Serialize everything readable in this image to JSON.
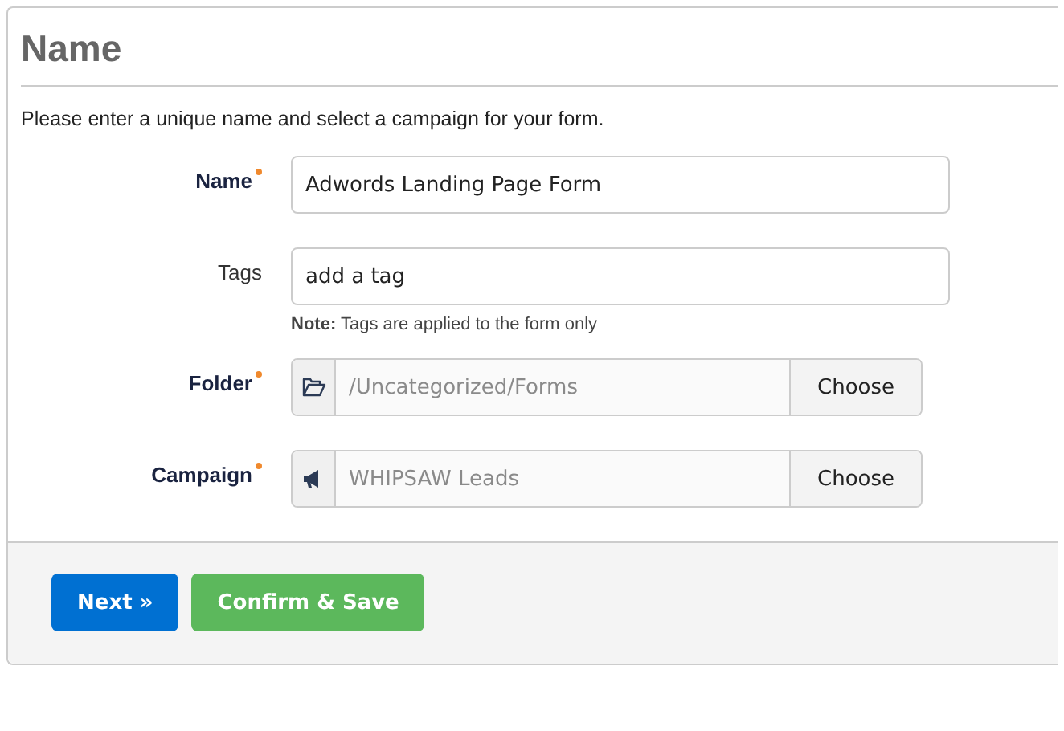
{
  "panel": {
    "title": "Name",
    "intro": "Please enter a unique name and select a campaign for your form.",
    "fields": [
      {
        "label": "Name",
        "required": true,
        "kind": "text",
        "value": "Adwords Landing Page Form"
      },
      {
        "label": "Tags",
        "required": false,
        "kind": "text",
        "value": "add a tag",
        "note": "**Note:** Tags are applied to the form only"
      },
      {
        "label": "Folder",
        "required": true,
        "kind": "folder",
        "placeholder": "/Uncategorized/Forms",
        "button": "Choose"
      },
      {
        "label": "Campaign",
        "required": true,
        "kind": "campaign",
        "placeholder": "WHIPSAW Leads",
        "button": "Choose"
      }
    ],
    "buttons": [
      {
        "label": "Next »",
        "kind": "primary"
      },
      {
        "label": "Confirm & Save",
        "kind": "success"
      }
    ]
  }
}
